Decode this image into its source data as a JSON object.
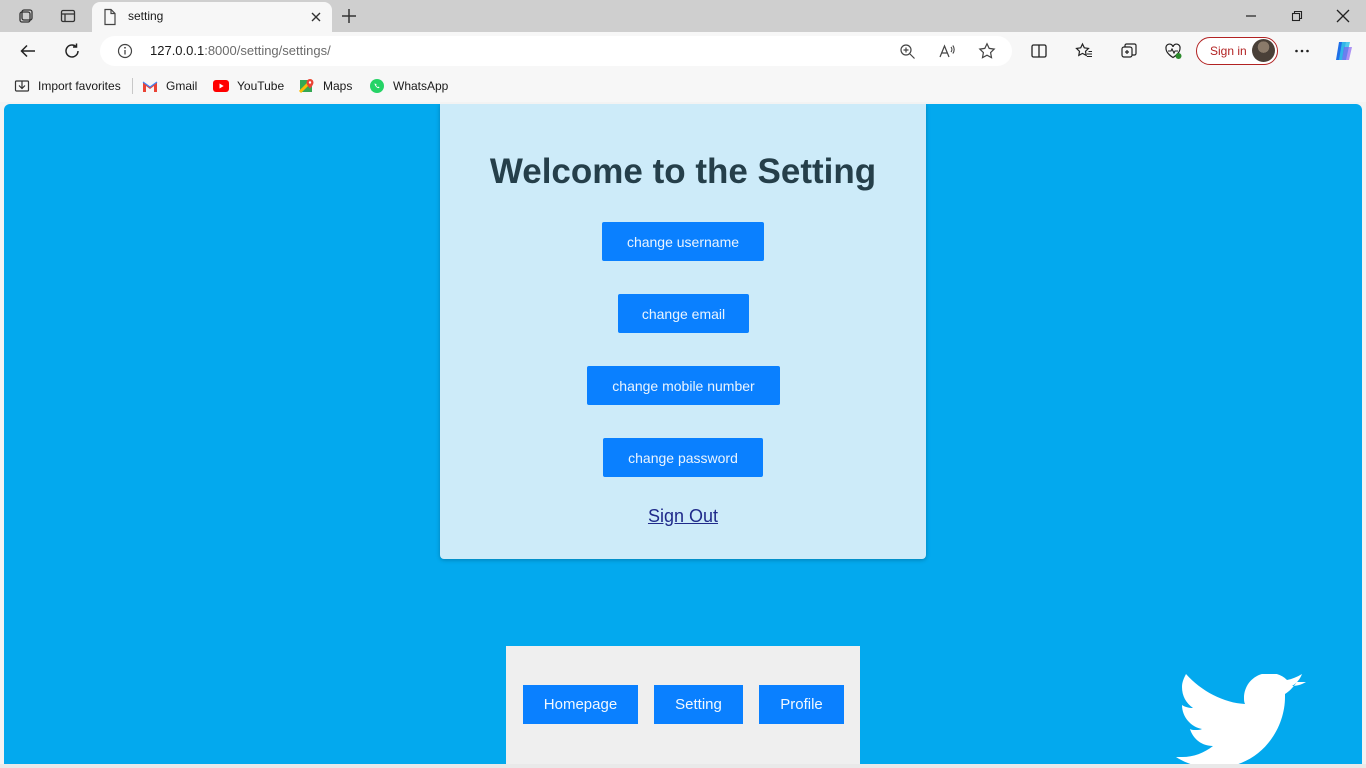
{
  "browser": {
    "tab_title": "setting",
    "url_host": "127.0.0.1",
    "url_rest": ":8000/setting/settings/",
    "signin_label": "Sign in"
  },
  "bookmarks": [
    {
      "label": "Import favorites",
      "icon": "import-icon"
    },
    {
      "label": "Gmail",
      "icon": "gmail-icon"
    },
    {
      "label": "YouTube",
      "icon": "youtube-icon"
    },
    {
      "label": "Maps",
      "icon": "maps-icon"
    },
    {
      "label": "WhatsApp",
      "icon": "whatsapp-icon"
    }
  ],
  "page": {
    "heading": "Welcome to the Setting",
    "actions": {
      "username": "change username",
      "email": "change email",
      "mobile": "change mobile number",
      "password": "change password"
    },
    "signout": "Sign Out",
    "nav": {
      "homepage": "Homepage",
      "setting": "Setting",
      "profile": "Profile"
    }
  },
  "colors": {
    "page_bg": "#03a9ee",
    "card_bg": "#cdebf9",
    "button": "#0a80ff",
    "heading": "#253f4a"
  }
}
